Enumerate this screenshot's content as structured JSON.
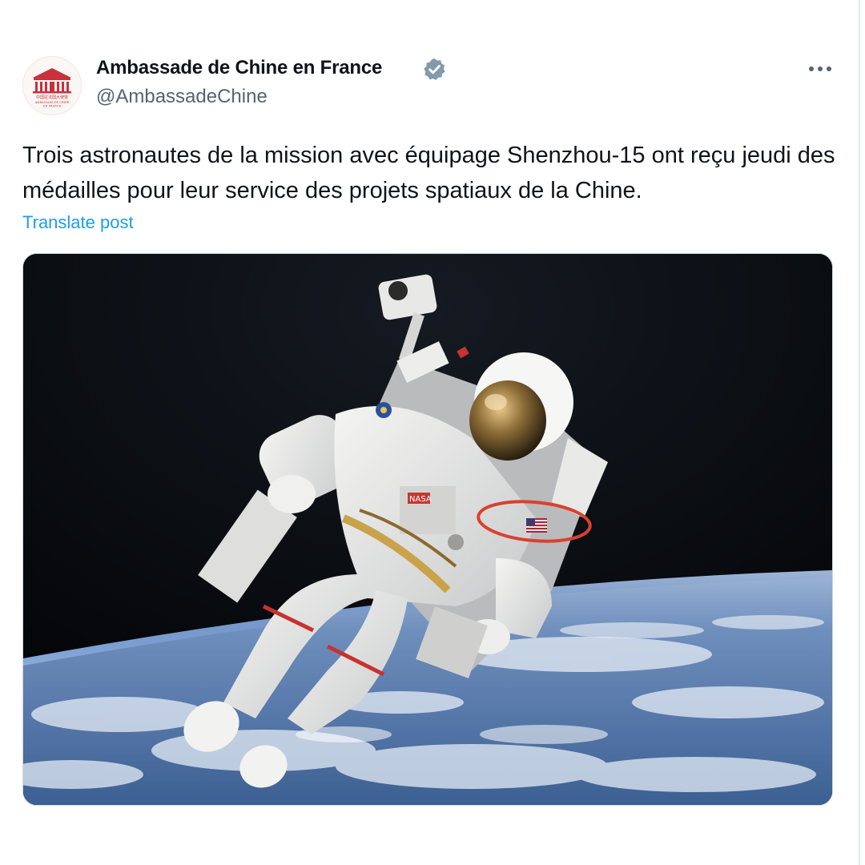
{
  "tweet": {
    "author": {
      "display_name": "Ambassade de Chine en France",
      "handle": "@AmbassadeChine",
      "verified": true,
      "avatar_icon": "embassy-logo-icon",
      "avatar_caption_cn": "中国驻法国大使馆",
      "avatar_caption_fr1": "AMBASSADE DE CHINE",
      "avatar_caption_fr2": "EN FRANCE"
    },
    "text": "Trois astronautes de la mission avec équipage Shenzhou-15 ont reçu jeudi des médailles pour leur service des projets spatiaux de la Chine.",
    "translate_label": "Translate post",
    "media": {
      "description_icon": "astronaut-photo",
      "badge_text": "NASA"
    },
    "menu_icon": "more-horizontal-icon"
  },
  "colors": {
    "text_primary": "#0f1419",
    "text_secondary": "#536471",
    "link": "#1d9bf0",
    "verified": "#829aab",
    "logo_red": "#c8323c",
    "annotation_red": "#d9412f"
  }
}
